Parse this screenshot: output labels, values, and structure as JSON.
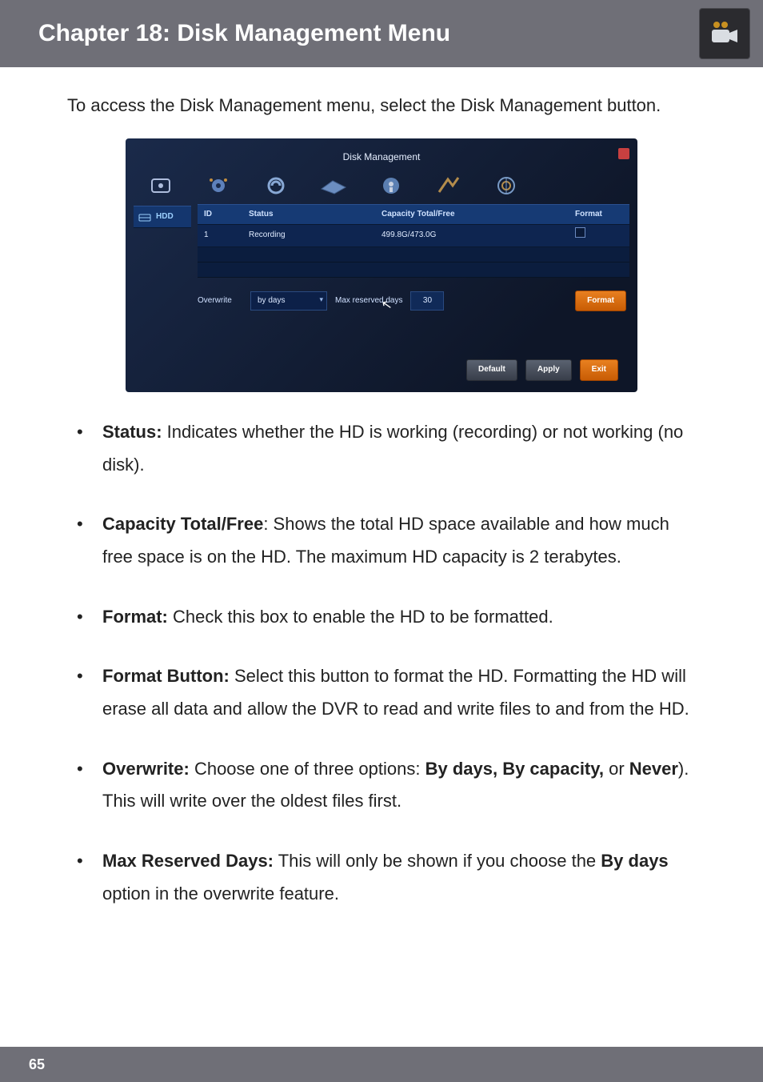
{
  "header": {
    "title": "Chapter 18: Disk Management Menu",
    "icon_name": "camera-icon"
  },
  "intro": "To access the Disk Management menu, select the Disk Management button.",
  "screenshot": {
    "window_title": "Disk Management",
    "sidebar": {
      "hdd_label": "HDD"
    },
    "table": {
      "headers": {
        "id": "ID",
        "status": "Status",
        "capacity": "Capacity Total/Free",
        "format": "Format"
      },
      "row": {
        "id": "1",
        "status": "Recording",
        "capacity": "499.8G/473.0G"
      }
    },
    "controls": {
      "overwrite_label": "Overwrite",
      "overwrite_value": "by days",
      "max_reserved_label": "Max reserved days",
      "max_reserved_value": "30",
      "format_btn": "Format"
    },
    "footer": {
      "default_btn": "Default",
      "apply_btn": "Apply",
      "exit_btn": "Exit"
    }
  },
  "bullets": {
    "status": {
      "label": "Status:",
      "text": " Indicates whether the HD is working (recording) or not working (no disk)."
    },
    "capacity": {
      "label": "Capacity Total/Free",
      "text": ": Shows the total HD space available and how much free space is on the HD. The maximum HD capacity is 2 terabytes."
    },
    "format": {
      "label": "Format:",
      "text": " Check this box to enable the HD to be formatted."
    },
    "format_button": {
      "label": "Format Button:",
      "text": " Select this button to format the HD. Formatting the HD will erase all data and allow the DVR to read and write files to and from the HD."
    },
    "overwrite": {
      "label": "Overwrite:",
      "text_a": " Choose one of three options: ",
      "opts": "By days, By capacity,",
      "text_b": " or ",
      "never": "Never",
      "text_c": "). This will write over the oldest files first."
    },
    "max_reserved": {
      "label": "Max Reserved Days:",
      "text_a": " This will only be shown if you choose the ",
      "by_days": "By days",
      "text_b": " option in the overwrite feature."
    }
  },
  "page_number": "65"
}
